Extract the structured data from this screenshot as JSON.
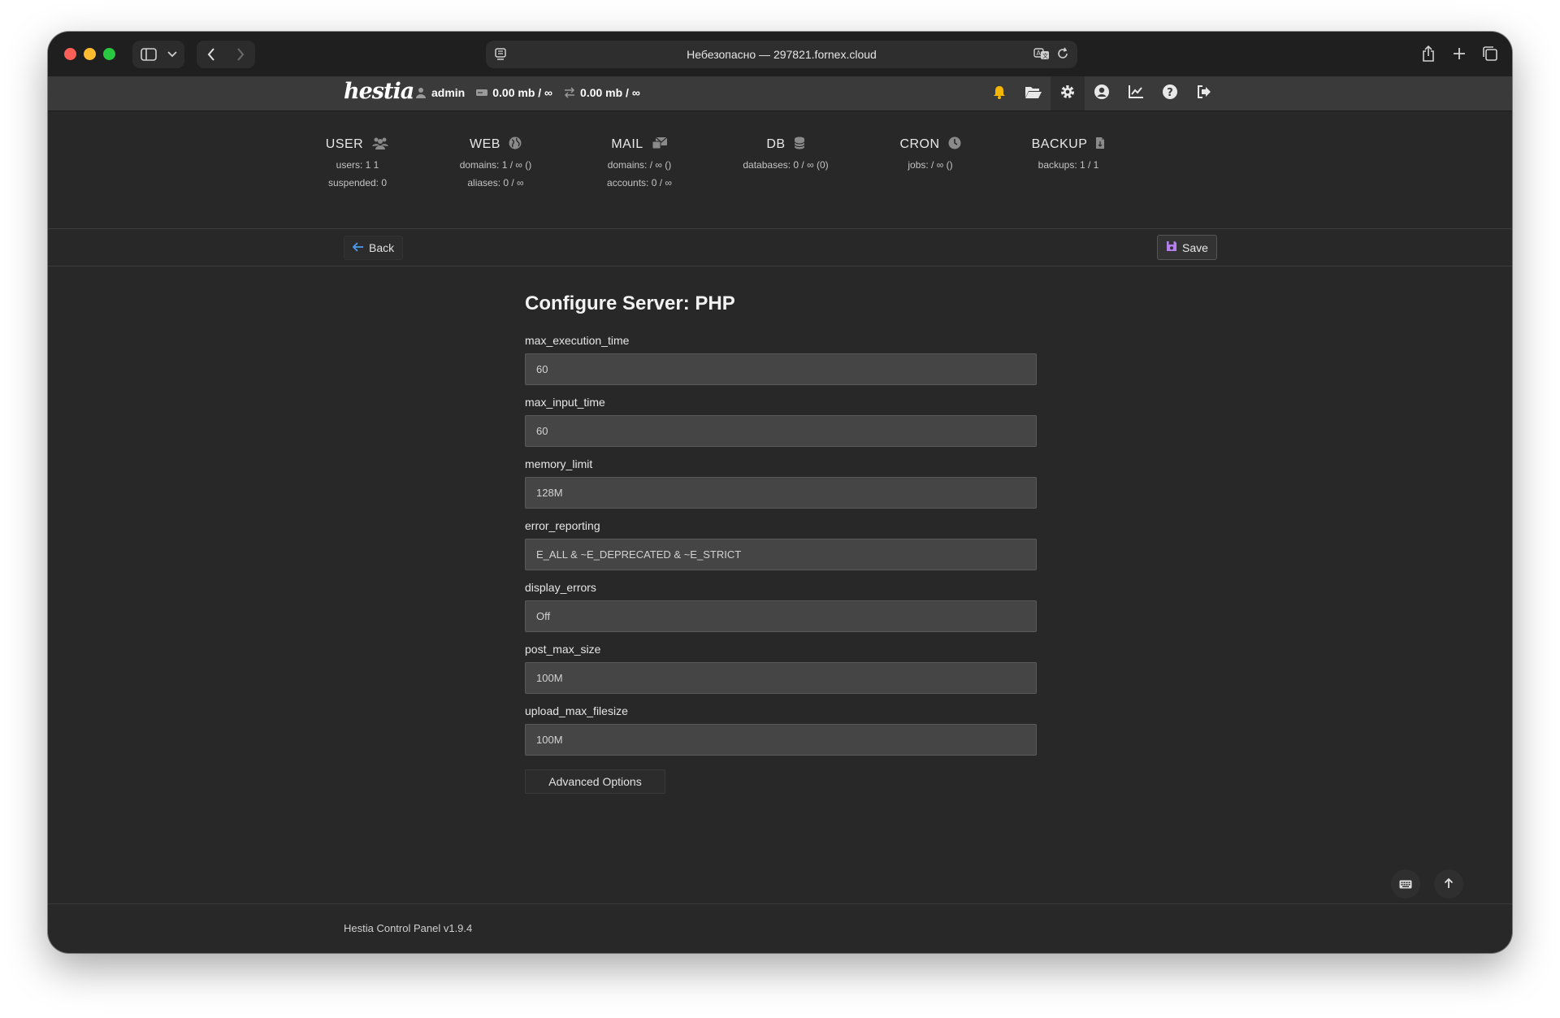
{
  "browser": {
    "address": "Небезопасно — 297821.fornex.cloud"
  },
  "topbar": {
    "logo": "hestia",
    "username": "admin",
    "disk_usage": "0.00 mb / ∞",
    "bandwidth_usage": "0.00 mb / ∞",
    "icons": [
      "bell-icon",
      "folder-icon",
      "gear-icon",
      "user-circle-icon",
      "chart-icon",
      "help-icon",
      "logout-icon"
    ]
  },
  "stats": [
    {
      "title": "USER",
      "icon": "users-icon",
      "lines": [
        "users: 1 1",
        "suspended: 0"
      ]
    },
    {
      "title": "WEB",
      "icon": "globe-icon",
      "lines": [
        "domains: 1 / ∞ ()",
        "aliases: 0 / ∞"
      ]
    },
    {
      "title": "MAIL",
      "icon": "mail-icon",
      "lines": [
        "domains: / ∞ ()",
        "accounts: 0 / ∞"
      ]
    },
    {
      "title": "DB",
      "icon": "database-icon",
      "lines": [
        "databases: 0 / ∞ (0)"
      ]
    },
    {
      "title": "CRON",
      "icon": "clock-icon",
      "lines": [
        "jobs: / ∞ ()"
      ]
    },
    {
      "title": "BACKUP",
      "icon": "file-icon",
      "lines": [
        "backups: 1 / 1"
      ]
    }
  ],
  "toolbar": {
    "back_label": "Back",
    "save_label": "Save"
  },
  "form": {
    "title": "Configure Server: PHP",
    "fields": [
      {
        "label": "max_execution_time",
        "value": "60"
      },
      {
        "label": "max_input_time",
        "value": "60"
      },
      {
        "label": "memory_limit",
        "value": "128M"
      },
      {
        "label": "error_reporting",
        "value": "E_ALL & ~E_DEPRECATED & ~E_STRICT"
      },
      {
        "label": "display_errors",
        "value": "Off"
      },
      {
        "label": "post_max_size",
        "value": "100M"
      },
      {
        "label": "upload_max_filesize",
        "value": "100M"
      }
    ],
    "advanced_label": "Advanced Options"
  },
  "footer": {
    "text": "Hestia Control Panel v1.9.4"
  },
  "colors": {
    "background": "#282828",
    "topbar": "#3a3a3a",
    "input": "#454545",
    "save_icon": "#b57ff0",
    "back_icon": "#4a9df0",
    "bell": "#f5b700"
  }
}
